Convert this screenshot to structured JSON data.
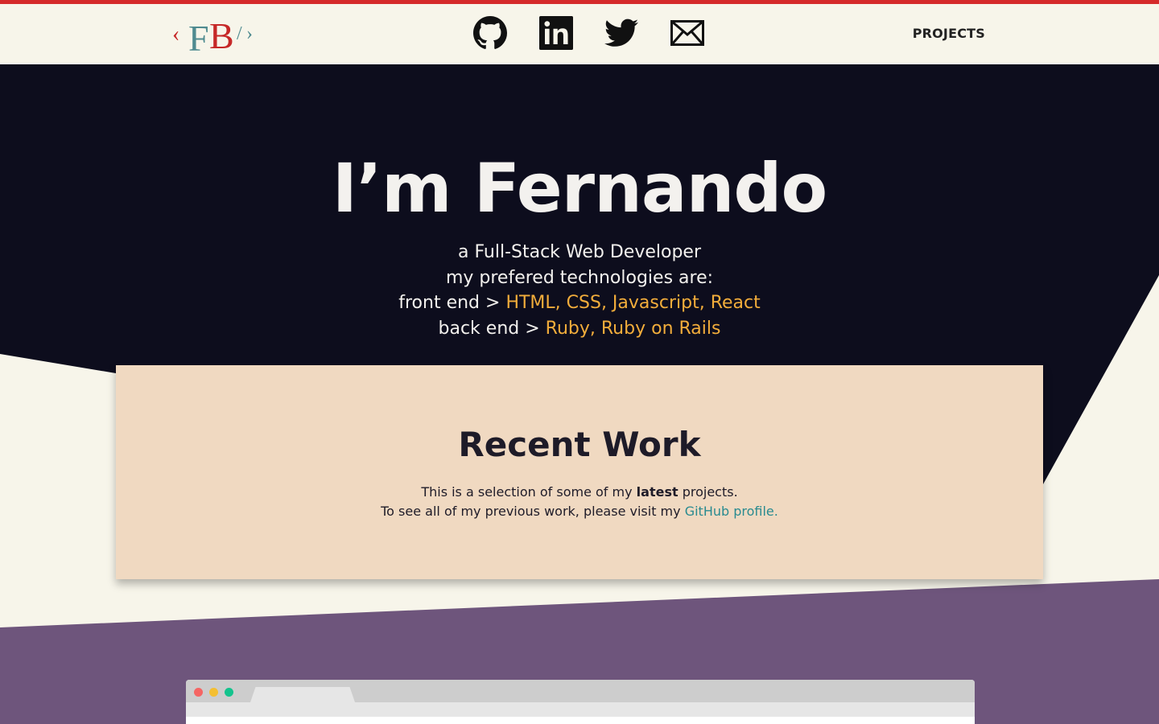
{
  "header": {
    "logo_text": "FB",
    "social_links": [
      {
        "name": "github",
        "icon": "github-icon"
      },
      {
        "name": "linkedin",
        "icon": "linkedin-icon"
      },
      {
        "name": "twitter",
        "icon": "twitter-icon"
      },
      {
        "name": "email",
        "icon": "mail-icon"
      }
    ],
    "nav": {
      "projects_label": "PROJECTS"
    }
  },
  "hero": {
    "title": "I’m Fernando",
    "line1": "a Full-Stack Web Developer",
    "line2": "my prefered technologies are:",
    "front_end_label": "front end >",
    "front_end_values": "HTML, CSS, Javascript, React",
    "back_end_label": "back end >",
    "back_end_values": "Ruby, Ruby on Rails"
  },
  "recent_work": {
    "title": "Recent Work",
    "text1_before": "This is a selection of some of my",
    "text1_strong": "latest",
    "text1_after": "projects.",
    "text2_before": "To see all of my previous work, please visit my",
    "github_link_text": "GitHub profile."
  },
  "colors": {
    "accent": "#f2ad3b",
    "dark_navy": "#0d0d1d",
    "cream": "#f7f5ea",
    "peach_card": "#f0d9c1",
    "purple": "#6e557c",
    "red": "#d52a2a",
    "teal": "#2a8b90"
  }
}
